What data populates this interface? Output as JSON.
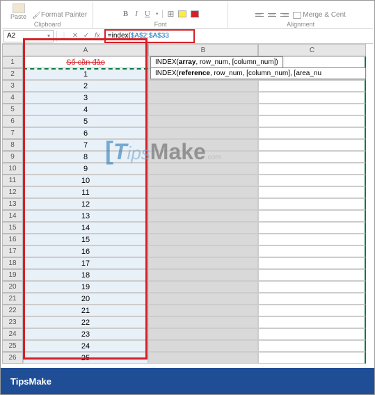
{
  "ribbon": {
    "paste": "Paste",
    "format_painter": "Format Painter",
    "clipboard_label": "Clipboard",
    "bold": "B",
    "italic": "I",
    "underline": "U",
    "font_label": "Font",
    "merge_label": "Merge & Cent",
    "alignment_label": "Alignment"
  },
  "namebox": {
    "ref": "A2"
  },
  "formula": {
    "fx": "fx",
    "prefix": "=index(",
    "range": "$A$2:$A$33"
  },
  "tooltip1": {
    "fn": "INDEX(",
    "arg1": "array",
    "rest": ", row_num, [column_num])"
  },
  "tooltip2": {
    "fn": "INDEX(",
    "arg1": "reference",
    "rest": ", row_num, [column_num], [area_nu"
  },
  "columns": [
    "A",
    "B",
    "C"
  ],
  "header_row_text": "Số cần đảo",
  "cell_b2": "=index($A$2:$A$33",
  "row_nums": [
    1,
    2,
    3,
    4,
    5,
    6,
    7,
    8,
    9,
    10,
    11,
    12,
    13,
    14,
    15,
    16,
    17,
    18,
    19,
    20,
    21,
    22,
    23,
    24,
    25,
    26
  ],
  "col_a_values": [
    "",
    1,
    2,
    3,
    4,
    5,
    6,
    7,
    8,
    9,
    10,
    11,
    12,
    13,
    14,
    15,
    16,
    17,
    18,
    19,
    20,
    21,
    22,
    23,
    24,
    25
  ],
  "watermark": {
    "t": "T",
    "ips": "ips",
    "make": "Make",
    "com": ".com"
  },
  "footer": "TipsMake"
}
